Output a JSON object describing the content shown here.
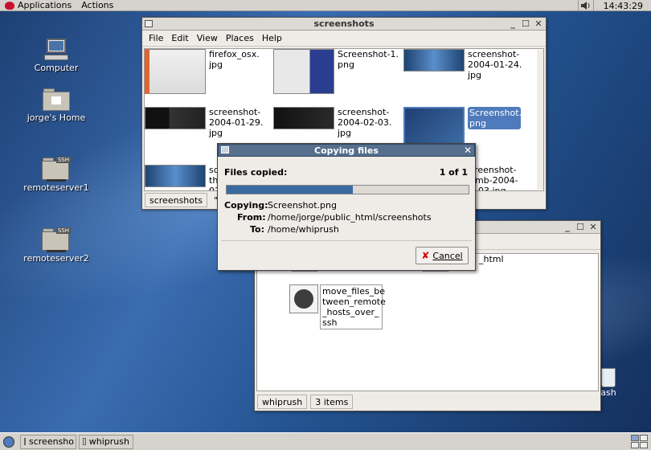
{
  "top_panel": {
    "applications": "Applications",
    "actions": "Actions",
    "clock": "14:43:29"
  },
  "desktop_icons": {
    "computer": "Computer",
    "home": "jorge's Home",
    "server1": "remoteserver1",
    "server2": "remoteserver2",
    "trash": "ash"
  },
  "screenshots_window": {
    "title": "screenshots",
    "menu": [
      "File",
      "Edit",
      "View",
      "Places",
      "Help"
    ],
    "files": [
      {
        "name": "firefox_osx.\njpg"
      },
      {
        "name": "Screenshot-1.\npng"
      },
      {
        "name": "screenshot-\n2004-01-24.\njpg"
      },
      {
        "name": "screenshot-\n2004-01-29.\njpg"
      },
      {
        "name": "screenshot-\n2004-02-03.\njpg"
      },
      {
        "name": "Screenshot.\npng"
      },
      {
        "name": "sc\nthu\n01"
      },
      {
        "name": "creenshot-\numb-2004-\n2-03.jpg"
      }
    ],
    "status_location": "screenshots",
    "status_text": "\"Sc"
  },
  "whiprush_window": {
    "partial_file": "_html",
    "file_name": "move_files_be\ntween_remote\n_hosts_over_\nssh",
    "status_location": "whiprush",
    "status_items": "3 items"
  },
  "dialog": {
    "title": "Copying files",
    "files_copied_label": "Files copied:",
    "files_copied_value": "1 of 1",
    "progress": 0.52,
    "copying_label": "Copying:",
    "copying_value": "Screenshot.png",
    "from_label": "From:",
    "from_value": "/home/jorge/public_html/screenshots",
    "to_label": "To:",
    "to_value": "/home/whiprush",
    "cancel_label": "Cancel"
  },
  "bottom_panel": {
    "tasks": [
      "screensho",
      "whiprush"
    ]
  }
}
